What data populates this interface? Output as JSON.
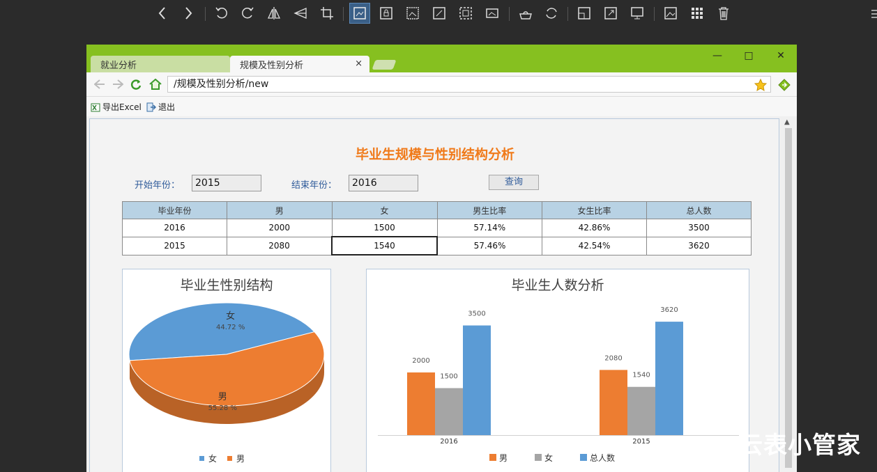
{
  "browser": {
    "tabs": [
      {
        "label": "就业分析"
      },
      {
        "label": "规模及性别分析"
      }
    ],
    "active_tab_close": "×",
    "address": "/规模及性别分析/new",
    "commands": {
      "export": "导出Excel",
      "exit": "退出"
    }
  },
  "report": {
    "title": "毕业生规模与性别结构分析",
    "start_label": "开始年份：",
    "start_value": "2015",
    "end_label": "结束年份：",
    "end_value": "2016",
    "query_label": "查询",
    "table": {
      "headers": [
        "毕业年份",
        "男",
        "女",
        "男生比率",
        "女生比率",
        "总人数"
      ],
      "rows": [
        [
          "2016",
          "2000",
          "1500",
          "57.14%",
          "42.86%",
          "3500"
        ],
        [
          "2015",
          "2080",
          "1540",
          "57.46%",
          "42.54%",
          "3620"
        ]
      ]
    }
  },
  "chart_data": [
    {
      "type": "pie",
      "title": "毕业生性别结构",
      "slices": [
        {
          "label": "女",
          "value": 44.72,
          "value_label": "44.72 %",
          "color": "#5b9bd5"
        },
        {
          "label": "男",
          "value": 55.28,
          "value_label": "55.28 %",
          "color": "#ed7d31"
        }
      ],
      "legend": [
        "女",
        "男"
      ],
      "legend_position": "bottom"
    },
    {
      "type": "bar",
      "title": "毕业生人数分析",
      "categories": [
        "2016",
        "2015"
      ],
      "series": [
        {
          "name": "男",
          "values": [
            2000,
            2080
          ],
          "color": "#ed7d31"
        },
        {
          "name": "女",
          "values": [
            1500,
            1540
          ],
          "color": "#a5a5a5"
        },
        {
          "name": "总人数",
          "values": [
            3500,
            3620
          ],
          "color": "#5b9bd5"
        }
      ],
      "ylim": [
        0,
        4000
      ],
      "legend_position": "bottom"
    }
  ],
  "watermark": "云表小管家",
  "colors": {
    "accent": "#f07a1a",
    "titlebar": "#86c020",
    "header": "#b8d2e4"
  }
}
